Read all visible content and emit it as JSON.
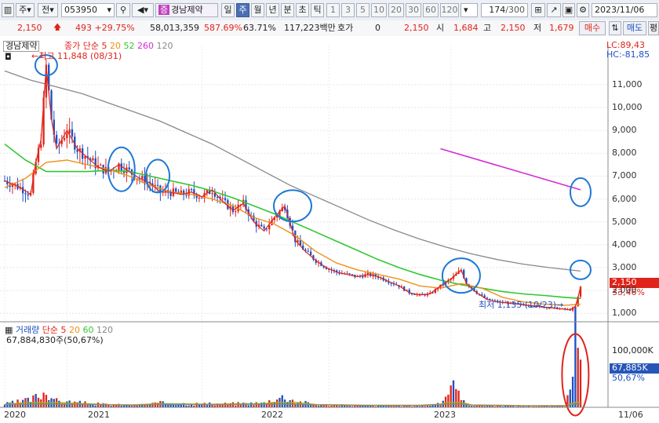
{
  "toolbar": {
    "market": "주",
    "mode": "전",
    "code": "053950",
    "stock_name": "경남제약",
    "stock_badge": "증",
    "periods": [
      "일",
      "주",
      "월",
      "년",
      "분",
      "초",
      "틱"
    ],
    "selected_period": "주",
    "intervals": [
      "1",
      "3",
      "5",
      "10",
      "20",
      "30",
      "60",
      "120"
    ],
    "count": "174",
    "count_total": "/300",
    "date": "2023/11/06"
  },
  "quote": {
    "price": "2,150",
    "change": "493 +29.75%",
    "volume": "58,013,359",
    "volume_pct": "587.69%",
    "turnover": "63.71%",
    "amount": "117,223백만",
    "hoga_label": "호가",
    "hoga_value": "0",
    "hoga_price": "2,150",
    "open_label": "시",
    "open": "1,684",
    "high_label": "고",
    "high": "2,150",
    "low_label": "저",
    "low": "1,679",
    "buy_label": "매수",
    "sell_label": "매도",
    "eval_label": "평"
  },
  "price_legend": {
    "name": "경남제약",
    "type": "종가 단순",
    "ma": [
      "5",
      "20",
      "52",
      "260",
      "120"
    ]
  },
  "volume_legend": {
    "name": "거래량",
    "type": "단순",
    "ma": [
      "5",
      "20",
      "60",
      "120"
    ],
    "value": "67,884,830주(50,67%)"
  },
  "markers": {
    "high": "최고 11,848 (08/31)",
    "low": "최저 1,135 (10/23)",
    "lc": "LC:89,43",
    "hc": "HC:-81,85",
    "cur_price": "2,150",
    "cur_pct": "33,46%",
    "vol_cur": "67,885K",
    "vol_pct": "50,67%"
  },
  "colors": {
    "up": "#e0241b",
    "down": "#1d4fc4",
    "ma5": "#e0241b",
    "ma20": "#f09018",
    "ma52": "#30c830",
    "ma260": "#d42cd4",
    "ma120": "#888888",
    "annotation": "#1e78d6"
  },
  "chart_data": [
    {
      "type": "candlestick",
      "title": "경남제약",
      "ylim": [
        700,
        12300
      ],
      "yticks": [
        "11,000",
        "10,000",
        "9,000",
        "8,000",
        "7,000",
        "6,000",
        "5,000",
        "4,000",
        "3,000",
        "2,000",
        "1,000"
      ],
      "xlabels": [
        "2020",
        "2021",
        "2022",
        "2023",
        "11/06"
      ],
      "close_path": [
        [
          0,
          6800
        ],
        [
          6,
          6500
        ],
        [
          10,
          6200
        ],
        [
          12,
          7600
        ],
        [
          14,
          8600
        ],
        [
          16,
          11800
        ],
        [
          18,
          9500
        ],
        [
          20,
          8200
        ],
        [
          24,
          9000
        ],
        [
          28,
          8200
        ],
        [
          32,
          7800
        ],
        [
          36,
          7400
        ],
        [
          40,
          7200
        ],
        [
          44,
          7500
        ],
        [
          48,
          7200
        ],
        [
          52,
          6900
        ],
        [
          56,
          6700
        ],
        [
          60,
          6300
        ],
        [
          64,
          6300
        ],
        [
          68,
          6200
        ],
        [
          72,
          6300
        ],
        [
          76,
          6100
        ],
        [
          80,
          6400
        ],
        [
          84,
          5900
        ],
        [
          88,
          5500
        ],
        [
          92,
          5800
        ],
        [
          96,
          5000
        ],
        [
          100,
          4600
        ],
        [
          104,
          5200
        ],
        [
          108,
          5700
        ],
        [
          112,
          4200
        ],
        [
          116,
          3700
        ],
        [
          120,
          3300
        ],
        [
          124,
          3000
        ],
        [
          128,
          2800
        ],
        [
          132,
          2700
        ],
        [
          136,
          2600
        ],
        [
          140,
          2700
        ],
        [
          144,
          2600
        ],
        [
          148,
          2400
        ],
        [
          152,
          2200
        ],
        [
          156,
          1900
        ],
        [
          160,
          1800
        ],
        [
          164,
          1850
        ],
        [
          168,
          2200
        ],
        [
          172,
          2500
        ],
        [
          174,
          2700
        ],
        [
          176,
          2900
        ],
        [
          178,
          2300
        ],
        [
          182,
          1900
        ],
        [
          186,
          1600
        ],
        [
          190,
          1500
        ],
        [
          194,
          1450
        ],
        [
          198,
          1400
        ],
        [
          202,
          1350
        ],
        [
          206,
          1300
        ],
        [
          210,
          1250
        ],
        [
          214,
          1200
        ],
        [
          216,
          1180
        ],
        [
          218,
          1150
        ],
        [
          220,
          1300
        ],
        [
          221,
          1700
        ],
        [
          222,
          2150
        ]
      ],
      "ma20_path": [
        [
          0,
          6500
        ],
        [
          8,
          6900
        ],
        [
          16,
          7600
        ],
        [
          24,
          7700
        ],
        [
          32,
          7500
        ],
        [
          40,
          7300
        ],
        [
          48,
          7000
        ],
        [
          56,
          6600
        ],
        [
          64,
          6300
        ],
        [
          72,
          6200
        ],
        [
          80,
          6000
        ],
        [
          88,
          5700
        ],
        [
          96,
          5200
        ],
        [
          104,
          4900
        ],
        [
          112,
          4400
        ],
        [
          120,
          3700
        ],
        [
          128,
          3200
        ],
        [
          136,
          2900
        ],
        [
          144,
          2700
        ],
        [
          152,
          2500
        ],
        [
          160,
          2200
        ],
        [
          168,
          2100
        ],
        [
          176,
          2300
        ],
        [
          184,
          2100
        ],
        [
          192,
          1700
        ],
        [
          200,
          1500
        ],
        [
          208,
          1400
        ],
        [
          216,
          1350
        ],
        [
          222,
          1400
        ]
      ],
      "ma52_path": [
        [
          0,
          8400
        ],
        [
          8,
          7700
        ],
        [
          16,
          7200
        ],
        [
          24,
          7200
        ],
        [
          32,
          7200
        ],
        [
          40,
          7250
        ],
        [
          48,
          7200
        ],
        [
          56,
          7000
        ],
        [
          64,
          6800
        ],
        [
          72,
          6600
        ],
        [
          80,
          6350
        ],
        [
          88,
          6050
        ],
        [
          96,
          5700
        ],
        [
          104,
          5350
        ],
        [
          112,
          4950
        ],
        [
          120,
          4550
        ],
        [
          128,
          4150
        ],
        [
          136,
          3750
        ],
        [
          144,
          3350
        ],
        [
          152,
          3000
        ],
        [
          160,
          2700
        ],
        [
          168,
          2450
        ],
        [
          176,
          2250
        ],
        [
          184,
          2100
        ],
        [
          192,
          1950
        ],
        [
          200,
          1850
        ],
        [
          208,
          1780
        ],
        [
          216,
          1700
        ],
        [
          222,
          1650
        ]
      ],
      "ma120_path": [
        [
          0,
          11600
        ],
        [
          10,
          11200
        ],
        [
          20,
          10900
        ],
        [
          30,
          10600
        ],
        [
          40,
          10200
        ],
        [
          50,
          9800
        ],
        [
          60,
          9400
        ],
        [
          70,
          8900
        ],
        [
          80,
          8400
        ],
        [
          90,
          7800
        ],
        [
          100,
          7200
        ],
        [
          110,
          6600
        ],
        [
          120,
          6100
        ],
        [
          130,
          5600
        ],
        [
          140,
          5100
        ],
        [
          150,
          4650
        ],
        [
          160,
          4250
        ],
        [
          170,
          3900
        ],
        [
          180,
          3600
        ],
        [
          190,
          3350
        ],
        [
          200,
          3150
        ],
        [
          210,
          3000
        ],
        [
          222,
          2850
        ]
      ],
      "ma260_path": [
        [
          168,
          8200
        ],
        [
          222,
          6400
        ]
      ],
      "high": 11848,
      "low": 1135,
      "last": 2150
    },
    {
      "type": "bar",
      "title": "거래량",
      "ylim": [
        0,
        140000
      ],
      "yticks": [
        "100,000K"
      ],
      "volume_k": [
        [
          0,
          6000
        ],
        [
          10,
          14000
        ],
        [
          16,
          30000
        ],
        [
          20,
          12000
        ],
        [
          30,
          8000
        ],
        [
          40,
          5000
        ],
        [
          50,
          4000
        ],
        [
          60,
          8000
        ],
        [
          80,
          6000
        ],
        [
          100,
          8000
        ],
        [
          104,
          16000
        ],
        [
          108,
          20000
        ],
        [
          112,
          12000
        ],
        [
          120,
          5000
        ],
        [
          140,
          3000
        ],
        [
          160,
          3000
        ],
        [
          168,
          6000
        ],
        [
          170,
          22000
        ],
        [
          172,
          45000
        ],
        [
          174,
          30000
        ],
        [
          176,
          12000
        ],
        [
          180,
          4000
        ],
        [
          200,
          2000
        ],
        [
          216,
          2000
        ],
        [
          220,
          130000
        ],
        [
          222,
          67885
        ]
      ]
    }
  ]
}
